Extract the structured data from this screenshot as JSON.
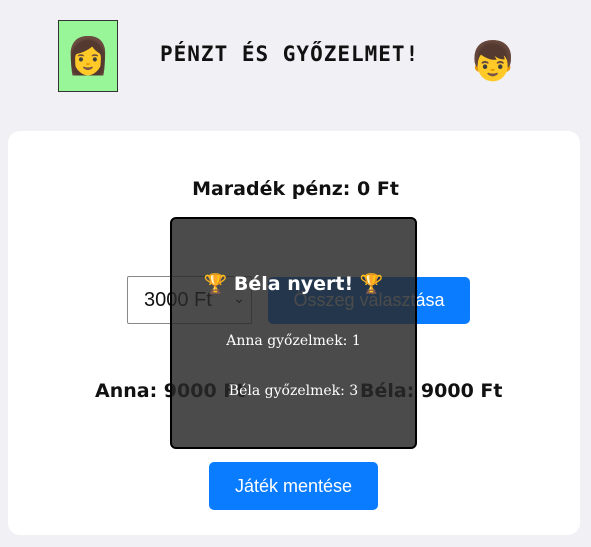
{
  "header": {
    "title": "PÉNZT ÉS GYŐZELMET!",
    "anna_avatar": "👩",
    "bela_avatar": "👦"
  },
  "game": {
    "remaining_money": "Maradék pénz: 0 Ft",
    "amount_selected": "3000 Ft",
    "choose_amount_label": "Összeg választása",
    "anna_money": "Anna: 9000 Ft",
    "bela_money": "Béla: 9000 Ft",
    "save_label": "Játék mentése"
  },
  "result_overlay": {
    "winner_text": "🏆 Béla nyert! 🏆",
    "anna_wins": "Anna győzelmek: 1",
    "bela_wins": "Béla győzelmek: 3"
  },
  "colors": {
    "accent": "#0a7cff",
    "anna_avatar_bg": "#98f598",
    "overlay_bg": "#2b2b2b"
  }
}
